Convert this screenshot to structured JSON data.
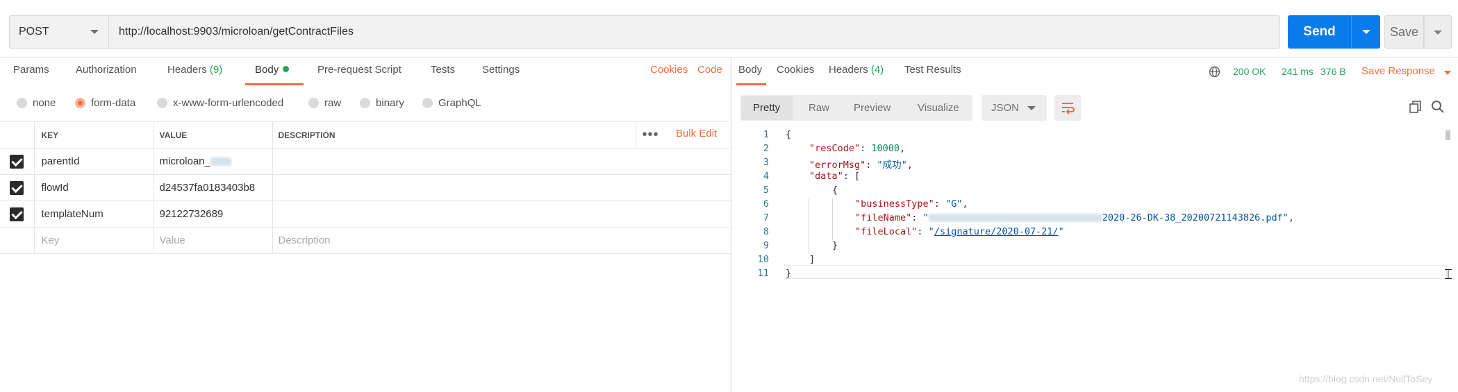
{
  "request": {
    "method": "POST",
    "url": "http://localhost:9903/microloan/getContractFiles",
    "send_label": "Send",
    "save_label": "Save"
  },
  "request_tabs": {
    "params": "Params",
    "authorization": "Authorization",
    "headers": "Headers",
    "headers_count": "(9)",
    "body": "Body",
    "prerequest": "Pre-request Script",
    "tests": "Tests",
    "settings": "Settings",
    "cookies": "Cookies",
    "code": "Code"
  },
  "body_types": [
    "none",
    "form-data",
    "x-www-form-urlencoded",
    "raw",
    "binary",
    "GraphQL"
  ],
  "body_type_selected": "form-data",
  "table": {
    "headers": {
      "key": "KEY",
      "value": "VALUE",
      "description": "DESCRIPTION"
    },
    "bulk_edit": "Bulk Edit",
    "more": "•••",
    "rows": [
      {
        "key": "parentId",
        "value": "microloan_",
        "description": ""
      },
      {
        "key": "flowId",
        "value": "d24537fa0183403b8",
        "description": ""
      },
      {
        "key": "templateNum",
        "value": "92122732689",
        "description": ""
      }
    ],
    "placeholder": {
      "key": "Key",
      "value": "Value",
      "description": "Description"
    }
  },
  "response_tabs": {
    "body": "Body",
    "cookies": "Cookies",
    "headers": "Headers",
    "headers_count": "(4)",
    "test_results": "Test Results"
  },
  "response_status": {
    "status": "200 OK",
    "time": "241 ms",
    "size": "376 B",
    "save_response": "Save Response"
  },
  "view_modes": [
    "Pretty",
    "Raw",
    "Preview",
    "Visualize"
  ],
  "format": "JSON",
  "code_lines": {
    "l1": "{",
    "l2_key": "\"resCode\"",
    "l2_val": "10000",
    "l3_key": "\"errorMsg\"",
    "l3_val": "\"成功\"",
    "l4_key": "\"data\"",
    "l4_rest": "[",
    "l5": "{",
    "l6_key": "\"businessType\"",
    "l6_val": "\"G\"",
    "l7_key": "\"fileName\"",
    "l7_val_start": "\"",
    "l7_val_end": "2020-26-DK-38_20200721143826.pdf\"",
    "l8_key": "\"fileLocal\"",
    "l8_q1": "\"",
    "l8_link": "/signature/2020-07-21/",
    "l8_q2": "\"",
    "l9": "}",
    "l10": "]",
    "l11": "}"
  },
  "watermark": "https://blog.csdn.net/NullToSey",
  "colors": {
    "accent": "#f26b3a",
    "primary": "#097bed",
    "success": "#27a35b"
  }
}
